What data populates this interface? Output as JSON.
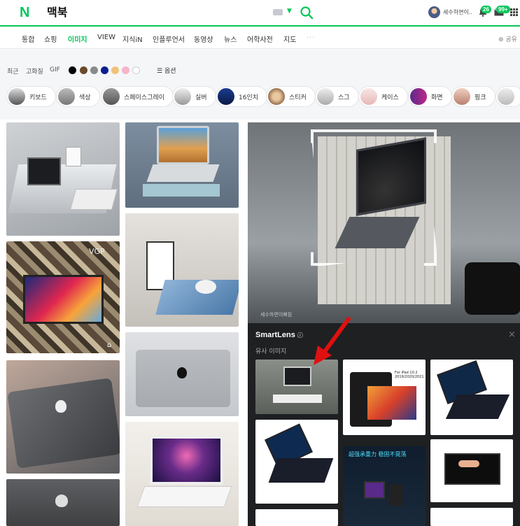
{
  "header": {
    "logo": "N",
    "query": "맥북",
    "username": "세수하면이..",
    "notifications_badge": "26",
    "mail_badge": "99+"
  },
  "tabs": [
    {
      "label": "통합",
      "active": false
    },
    {
      "label": "쇼핑",
      "active": false
    },
    {
      "label": "이미지",
      "active": true
    },
    {
      "label": "VIEW",
      "active": false
    },
    {
      "label": "지식iN",
      "active": false
    },
    {
      "label": "인플루언서",
      "active": false
    },
    {
      "label": "동영상",
      "active": false
    },
    {
      "label": "뉴스",
      "active": false
    },
    {
      "label": "어학사전",
      "active": false
    },
    {
      "label": "지도",
      "active": false
    }
  ],
  "tabs_more": "···",
  "share_label": "공유",
  "filters": {
    "recent": "최근",
    "hires": "고화질",
    "gif": "GIF",
    "options": "옵션",
    "colors": [
      "#000000",
      "#6b4a2b",
      "#8a8a8a",
      "#0a1f8f",
      "#f0c27a",
      "#f4b6c8",
      "#ffffff"
    ]
  },
  "chips": [
    "키보드",
    "색상",
    "스페이스그레이",
    "실버",
    "16인치",
    "스티커",
    "스그",
    "케이스",
    "화면",
    "핑크"
  ],
  "watermark": "세수하면이뻐짐",
  "smartlens": {
    "title": "SmartLens",
    "subtitle": "유사 이미지",
    "close": "×"
  },
  "result_tiles": {
    "tablet_text": "For iPad 10.2 2019/2020/2021",
    "cn_text": "超强承重力 稳固不晃荡",
    "vgp_text": "VGP"
  }
}
